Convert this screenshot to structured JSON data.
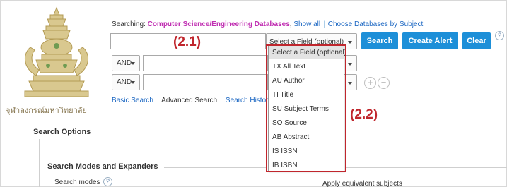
{
  "logo": {
    "caption": "จุฬาลงกรณ์มหาวิทยาลัย"
  },
  "searching": {
    "prefix": "Searching: ",
    "databases": "Computer Science/Engineering Databases",
    "comma": ",",
    "show_all": "Show all",
    "choose": "Choose Databases by Subject"
  },
  "rows": [
    {
      "bool": "",
      "value": "",
      "field": "Select a Field (optional)"
    },
    {
      "bool": "AND",
      "value": "",
      "field": ""
    },
    {
      "bool": "AND",
      "value": "",
      "field": ""
    }
  ],
  "buttons": {
    "search": "Search",
    "create_alert": "Create Alert",
    "clear": "Clear",
    "help": "?"
  },
  "row_controls": {
    "add": "+",
    "remove": "−"
  },
  "links": {
    "basic": "Basic Search",
    "advanced": "Advanced Search",
    "history": "Search History"
  },
  "dropdown": {
    "items": [
      "Select a Field (optional)",
      "TX All Text",
      "AU Author",
      "TI Title",
      "SU Subject Terms",
      "SO Source",
      "AB Abstract",
      "IS ISSN",
      "IB ISBN"
    ],
    "selected_index": 0
  },
  "annotations": {
    "label_1": "(2.1)",
    "label_2": "(2.2)",
    "color": "#c0262d"
  },
  "options": {
    "title": "Search Options",
    "modes_title": "Search Modes and Expanders",
    "search_modes": "Search modes",
    "help": "?",
    "apply_equivalent": "Apply equivalent subjects"
  },
  "colors": {
    "accent": "#1d8fd8",
    "db_highlight": "#c02fb2",
    "link": "#1a66c2"
  }
}
